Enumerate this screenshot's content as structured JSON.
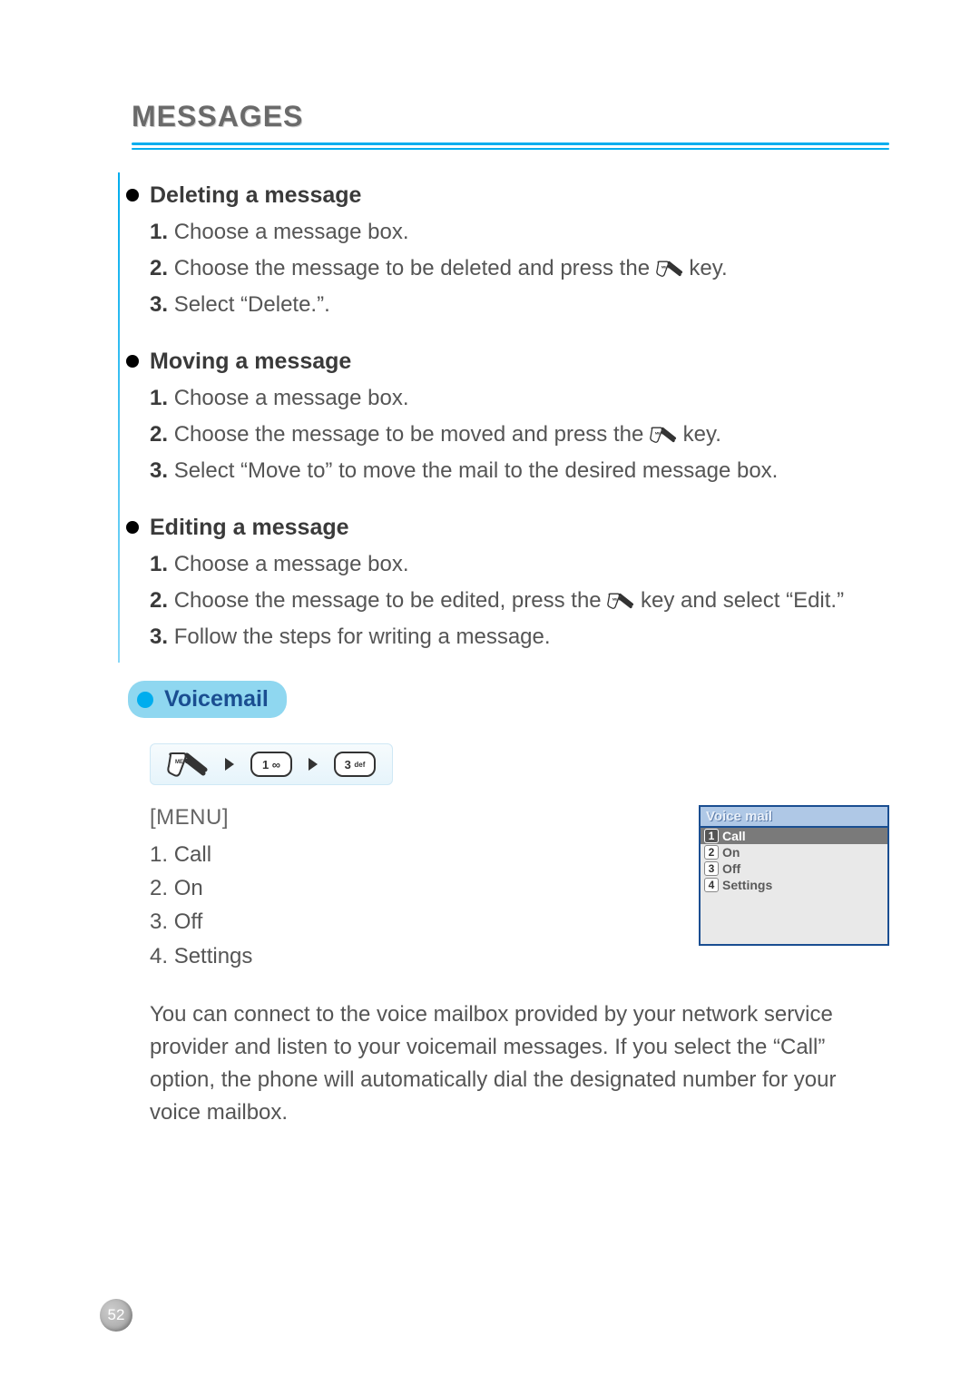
{
  "page": {
    "title": "MESSAGES",
    "number": "52"
  },
  "sections": [
    {
      "heading": "Deleting a message",
      "steps": [
        {
          "n": "1.",
          "pre": "Choose a message box.",
          "has_key": false,
          "post": ""
        },
        {
          "n": "2.",
          "pre": "Choose the message to be deleted and press the ",
          "has_key": true,
          "post": " key."
        },
        {
          "n": "3.",
          "pre": "Select “Delete.”.",
          "has_key": false,
          "post": ""
        }
      ]
    },
    {
      "heading": "Moving a message",
      "steps": [
        {
          "n": "1.",
          "pre": "Choose a message box.",
          "has_key": false,
          "post": ""
        },
        {
          "n": "2.",
          "pre": "Choose the message to be moved and press the ",
          "has_key": true,
          "post": " key."
        },
        {
          "n": "3.",
          "pre": "Select “Move to” to move the mail to the desired message box.",
          "has_key": false,
          "post": ""
        }
      ]
    },
    {
      "heading": "Editing a message",
      "steps": [
        {
          "n": "1.",
          "pre": "Choose a message box.",
          "has_key": false,
          "post": ""
        },
        {
          "n": "2.",
          "pre": "Choose the message to be edited, press the ",
          "has_key": true,
          "post": " key and select “Edit.”"
        },
        {
          "n": "3.",
          "pre": "Follow the steps for writing a message.",
          "has_key": false,
          "post": ""
        }
      ]
    }
  ],
  "voicemail": {
    "pill": "Voicemail",
    "key_sequence": [
      "menu",
      "1",
      "3def"
    ],
    "menu_header": "[MENU]",
    "menu_items": [
      {
        "n": "1.",
        "label": "Call"
      },
      {
        "n": "2.",
        "label": "On"
      },
      {
        "n": "3.",
        "label": "Off"
      },
      {
        "n": "4.",
        "label": "Settings"
      }
    ],
    "screen": {
      "title": "Voice mail",
      "items": [
        {
          "n": "1",
          "label": "Call",
          "selected": true
        },
        {
          "n": "2",
          "label": "On",
          "selected": false
        },
        {
          "n": "3",
          "label": "Off",
          "selected": false
        },
        {
          "n": "4",
          "label": "Settings",
          "selected": false
        }
      ]
    },
    "paragraph": "You can connect to the voice mailbox provided by your network service provider and listen to your voicemail messages. If you select the “Call” option, the phone will automatically dial the designated number for your voice mailbox."
  }
}
